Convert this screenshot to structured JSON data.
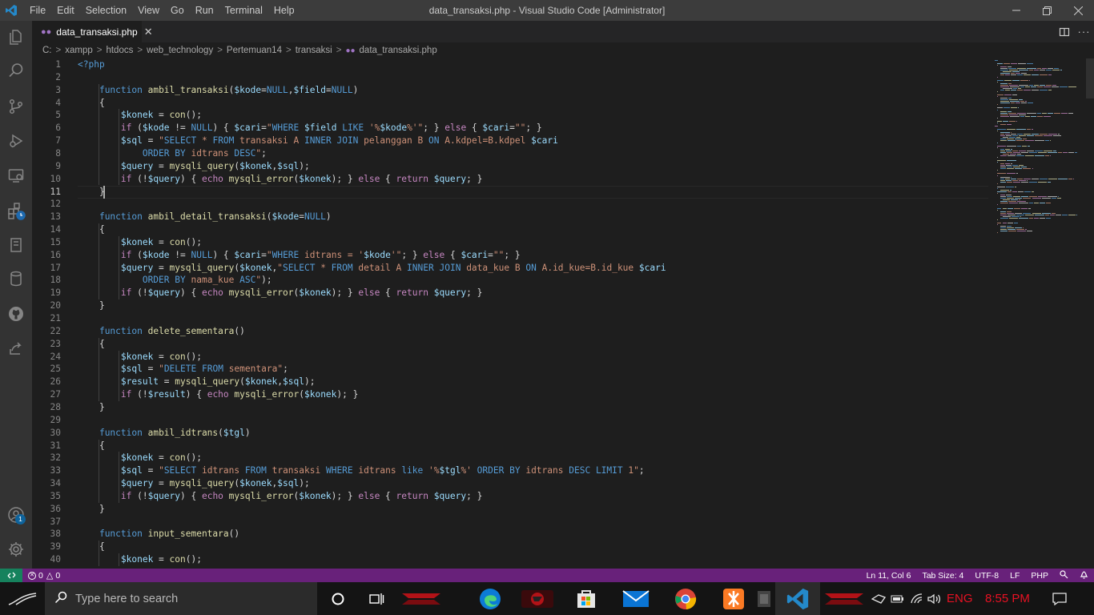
{
  "window": {
    "title": "data_transaksi.php - Visual Studio Code [Administrator]",
    "menu": [
      "File",
      "Edit",
      "Selection",
      "View",
      "Go",
      "Run",
      "Terminal",
      "Help"
    ]
  },
  "tabs": [
    {
      "label": "data_transaksi.php",
      "icon": "php-elephant-icon"
    }
  ],
  "breadcrumb": [
    "C:",
    "xampp",
    "htdocs",
    "web_technology",
    "Pertemuan14",
    "transaksi",
    "data_transaksi.php"
  ],
  "editor": {
    "active_line": 11,
    "lines": [
      "<?php",
      "",
      "    function ambil_transaksi($kode=NULL,$field=NULL)",
      "    {",
      "        $konek = con();",
      "        if ($kode != NULL) { $cari=\"WHERE $field LIKE '%$kode%'\"; } else { $cari=\"\"; }",
      "        $sql = \"SELECT * FROM transaksi A INNER JOIN pelanggan B ON A.kdpel=B.kdpel $cari",
      "            ORDER BY idtrans DESC\";",
      "        $query = mysqli_query($konek,$sql);",
      "        if (!$query) { echo mysqli_error($konek); } else { return $query; }",
      "    }",
      "",
      "    function ambil_detail_transaksi($kode=NULL)",
      "    {",
      "        $konek = con();",
      "        if ($kode != NULL) { $cari=\"WHERE idtrans = '$kode'\"; } else { $cari=\"\"; }",
      "        $query = mysqli_query($konek,\"SELECT * FROM detail A INNER JOIN data_kue B ON A.id_kue=B.id_kue $cari",
      "            ORDER BY nama_kue ASC\");",
      "        if (!$query) { echo mysqli_error($konek); } else { return $query; }",
      "    }",
      "",
      "    function delete_sementara()",
      "    {",
      "        $konek = con();",
      "        $sql = \"DELETE FROM sementara\";",
      "        $result = mysqli_query($konek,$sql);",
      "        if (!$result) { echo mysqli_error($konek); }",
      "    }",
      "",
      "    function ambil_idtrans($tgl)",
      "    {",
      "        $konek = con();",
      "        $sql = \"SELECT idtrans FROM transaksi WHERE idtrans like '%$tgl%' ORDER BY idtrans DESC LIMIT 1\";",
      "        $query = mysqli_query($konek,$sql);",
      "        if (!$query) { echo mysqli_error($konek); } else { return $query; }",
      "    }",
      "",
      "    function input_sementara()",
      "    {",
      "        $konek = con();"
    ]
  },
  "status": {
    "errors": "0",
    "warnings": "0",
    "position": "Ln 11, Col 6",
    "tab_size": "Tab Size: 4",
    "encoding": "UTF-8",
    "eol": "LF",
    "language": "PHP"
  },
  "taskbar": {
    "search_placeholder": "Type here to search",
    "language": "ENG",
    "time": "8:55 PM"
  },
  "activity_badge": "1",
  "colors": {
    "status_bar": "#68217a",
    "remote": "#16825d",
    "keyword": "#569cd6",
    "control": "#c586c0",
    "function": "#dcdcaa",
    "variable": "#9cdcfe",
    "string": "#ce9178",
    "clock": "#e81123"
  }
}
